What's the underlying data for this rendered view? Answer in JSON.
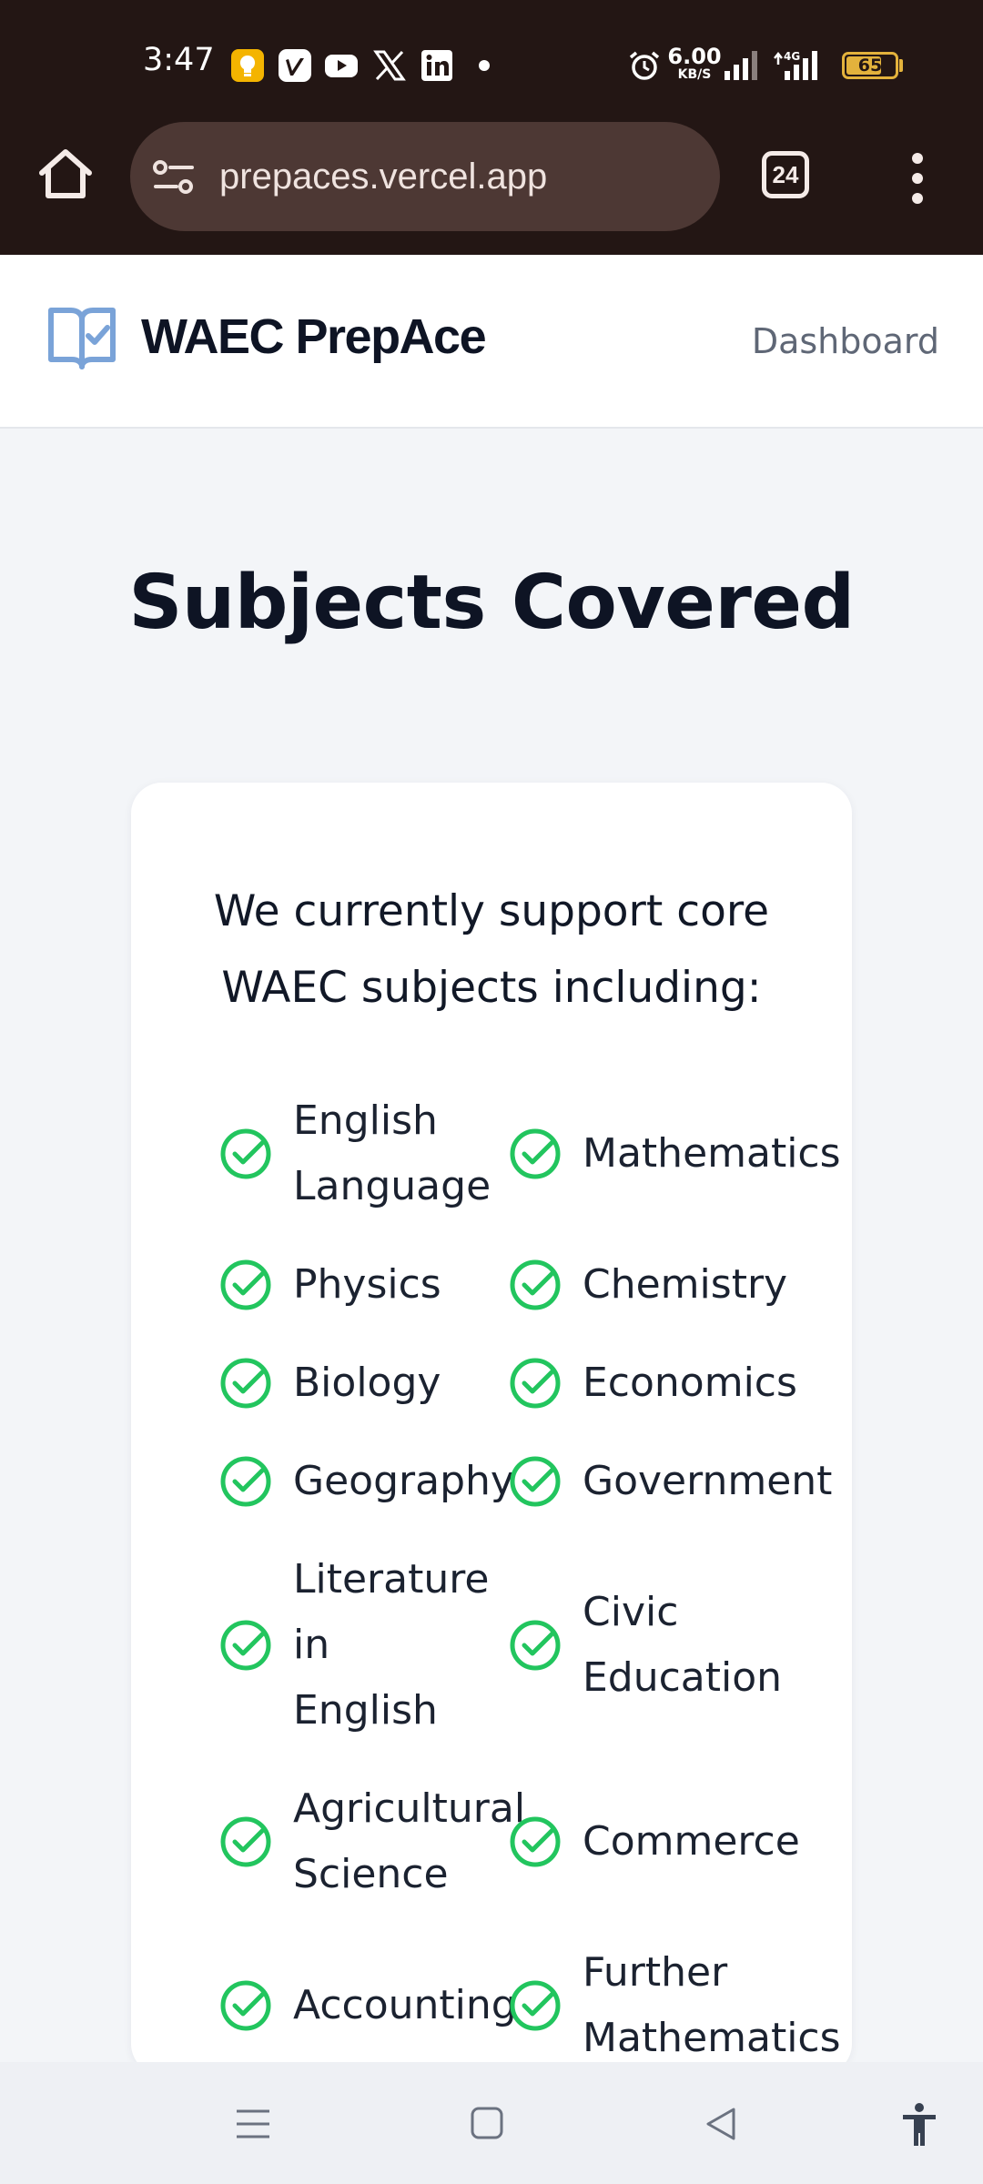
{
  "status_bar": {
    "time": "3:47",
    "notification_icons": [
      "keep-notes-icon",
      "vimeo-icon",
      "youtube-icon",
      "x-icon",
      "linkedin-icon"
    ],
    "net_speed_value": "6.00",
    "net_speed_unit": "KB/S",
    "network_type": "4G",
    "battery": "65"
  },
  "browser": {
    "url": "prepaces.vercel.app",
    "tab_count": "24"
  },
  "header": {
    "brand": "WAEC PrepAce",
    "nav_link": "Dashboard"
  },
  "main": {
    "title": "Subjects Covered",
    "intro_line1": "We currently support core",
    "intro_line2": "WAEC subjects including:",
    "subjects": [
      {
        "lines": [
          "English",
          "Language"
        ]
      },
      {
        "lines": [
          "Mathematics"
        ]
      },
      {
        "lines": [
          "Physics"
        ]
      },
      {
        "lines": [
          "Chemistry"
        ]
      },
      {
        "lines": [
          "Biology"
        ]
      },
      {
        "lines": [
          "Economics"
        ]
      },
      {
        "lines": [
          "Geography"
        ]
      },
      {
        "lines": [
          "Government"
        ]
      },
      {
        "lines": [
          "Literature",
          "in",
          "English"
        ]
      },
      {
        "lines": [
          "Civic",
          "Education"
        ]
      },
      {
        "lines": [
          "Agricultural",
          "Science"
        ]
      },
      {
        "lines": [
          "Commerce"
        ]
      },
      {
        "lines": [
          "Accounting"
        ]
      },
      {
        "lines": [
          "Further",
          "Mathematics"
        ]
      }
    ]
  },
  "colors": {
    "chrome_bg": "#231614",
    "check_green": "#22c55e",
    "logo_blue": "#7aa3d8",
    "page_bg": "#f3f5f8"
  }
}
